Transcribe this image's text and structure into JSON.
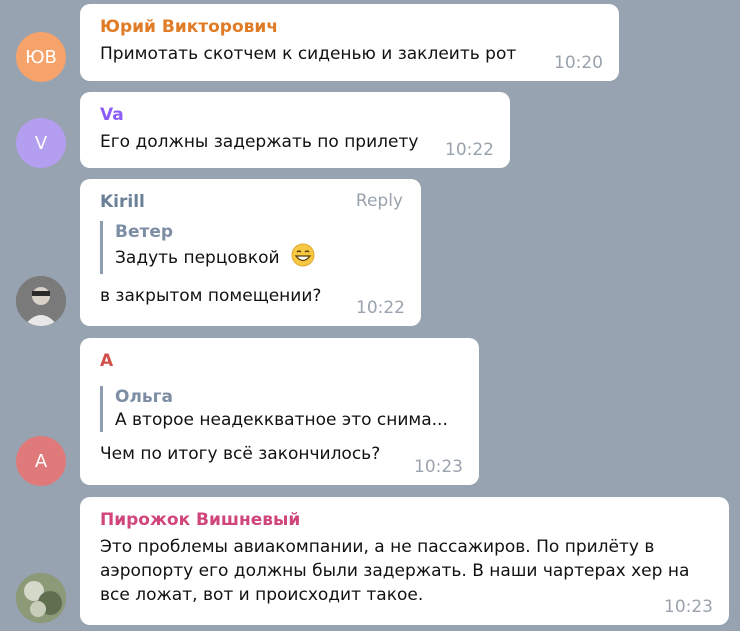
{
  "colors": {
    "background": "#98a3b2",
    "bubble": "#ffffff",
    "time": "#9aa3ad",
    "quote_bar": "#8e9bb0"
  },
  "messages": [
    {
      "sender": "Юрий Викторович",
      "sender_color": "#e07b26",
      "avatar": {
        "initials": "ЮВ",
        "color": "#f5a36a"
      },
      "text": "Примотать скотчем к сиденью и заклеить рот",
      "time": "10:20"
    },
    {
      "sender": "Va",
      "sender_color": "#8b5cf6",
      "avatar": {
        "initials": "V",
        "color": "#b39ef0"
      },
      "text": "Его должны задержать по прилету",
      "time": "10:22"
    },
    {
      "sender": "Kirill",
      "sender_color": "#6b8097",
      "avatar": {
        "initials": "",
        "color": "#6f6f6f"
      },
      "reply_label": "Reply",
      "quote": {
        "name": "Ветер",
        "text": "Задуть перцовкой",
        "emoji": "grinning-face-icon"
      },
      "text": "в закрытом помещении?",
      "time": "10:22"
    },
    {
      "sender": "A",
      "sender_color": "#d2504b",
      "avatar": {
        "initials": "A",
        "color": "#e07a7a"
      },
      "quote": {
        "name": "Ольга",
        "text": "А второе неадеккватное это снима..."
      },
      "text": "Чем по итогу всё закончилось?",
      "time": "10:23"
    },
    {
      "sender": "Пирожок Вишневый",
      "sender_color": "#d0457a",
      "avatar": {
        "initials": "",
        "color": "#7f8b6a"
      },
      "text": "Это проблемы авиакомпании, а не пассажиров. По прилёту в аэропорту его должны были задержать. В наши чартерах хер на все ложат, вот и происходит такое.",
      "time": "10:23"
    }
  ]
}
